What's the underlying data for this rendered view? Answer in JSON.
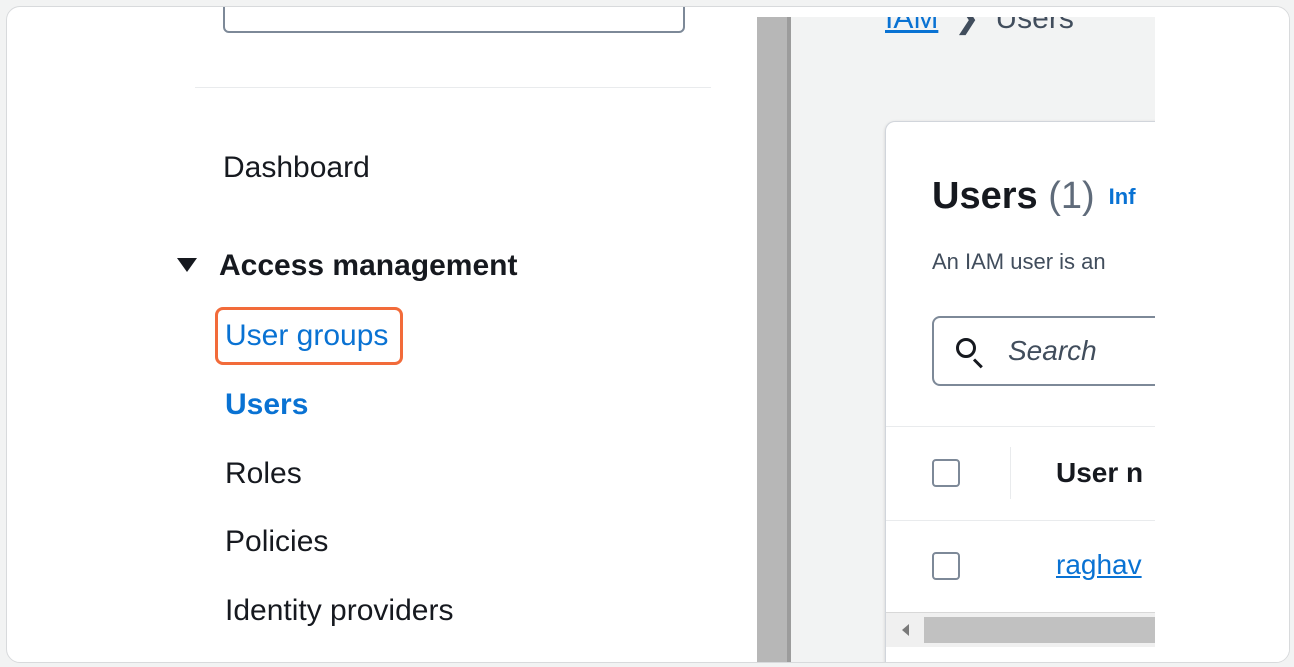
{
  "nav": {
    "items": [
      {
        "label": "Dashboard"
      },
      {
        "label": "User groups"
      },
      {
        "label": "Users"
      },
      {
        "label": "Roles"
      },
      {
        "label": "Policies"
      },
      {
        "label": "Identity providers"
      }
    ],
    "section_label": "Access management",
    "active_item": "Users",
    "highlighted_item": "User groups"
  },
  "breadcrumb": {
    "root": "IAM",
    "current": "Users"
  },
  "users_panel": {
    "title": "Users",
    "count": "(1)",
    "info_link": "Inf",
    "description": "An IAM user is an",
    "search_placeholder": "Search",
    "column_header": "User n",
    "rows": [
      {
        "user_name": "raghav"
      }
    ]
  },
  "colors": {
    "link_blue": "#0972d3",
    "highlight_orange": "#f26b3a",
    "text_dark": "#16191f"
  }
}
